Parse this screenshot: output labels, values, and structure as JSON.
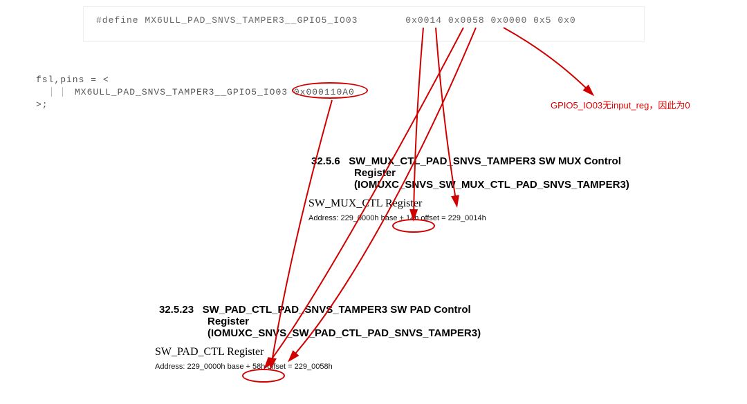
{
  "code": {
    "define_line": "#define MX6ULL_PAD_SNVS_TAMPER3__GPIO5_IO03",
    "define_values": "0x0014 0x0058 0x0000 0x5 0x0",
    "fsl_line1": "fsl,pins = <",
    "fsl_line2": "MX6ULL_PAD_SNVS_TAMPER3__GPIO5_IO03 0x000110A0",
    "fsl_close": ">;",
    "circled_value": "0x000110A0"
  },
  "annotation": "GPIO5_IO03无input_reg，因此为0",
  "section1": {
    "number": "32.5.6",
    "title_line1": "SW_MUX_CTL_PAD_SNVS_TAMPER3 SW MUX Control",
    "title_line2": "Register",
    "title_line3": "(IOMUXC_SNVS_SW_MUX_CTL_PAD_SNVS_TAMPER3)",
    "subtitle": "SW_MUX_CTL Register",
    "address_pre": "Address: 229_0000h base + ",
    "address_offset": "14h offset",
    "address_post": " = 229_0014h"
  },
  "section2": {
    "number": "32.5.23",
    "title_line1": "SW_PAD_CTL_PAD_SNVS_TAMPER3 SW PAD Control",
    "title_line2": "Register",
    "title_line3": "(IOMUXC_SNVS_SW_PAD_CTL_PAD_SNVS_TAMPER3)",
    "subtitle": "SW_PAD_CTL Register",
    "address_pre": "Address: 229_0000h base + ",
    "address_offset": "58h offset",
    "address_post": " = 229_0058h"
  }
}
